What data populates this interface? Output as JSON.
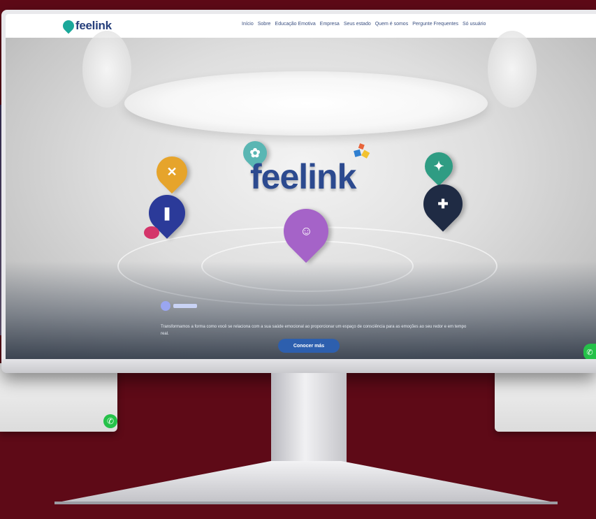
{
  "nav": {
    "logo_text": "feelink",
    "menu": [
      "Início",
      "Sobre",
      "Educação Emotiva",
      "Empresa",
      "Seus estado",
      "Quem é somos",
      "Pergunte Frequentes",
      "Só usuário"
    ]
  },
  "hero": {
    "brand": "feelink",
    "description": "Transformamos a forma como você se relaciona com a sua saúde emocional ao proporcionar um espaço de consciência para as emoções ao seu redor e em tempo real.",
    "cta_label": "Conocer más"
  },
  "colors": {
    "background": "#5e0a17",
    "brand_blue": "#2c4a8f",
    "cta_blue": "#2d5fae",
    "whatsapp_green": "#25c149"
  }
}
